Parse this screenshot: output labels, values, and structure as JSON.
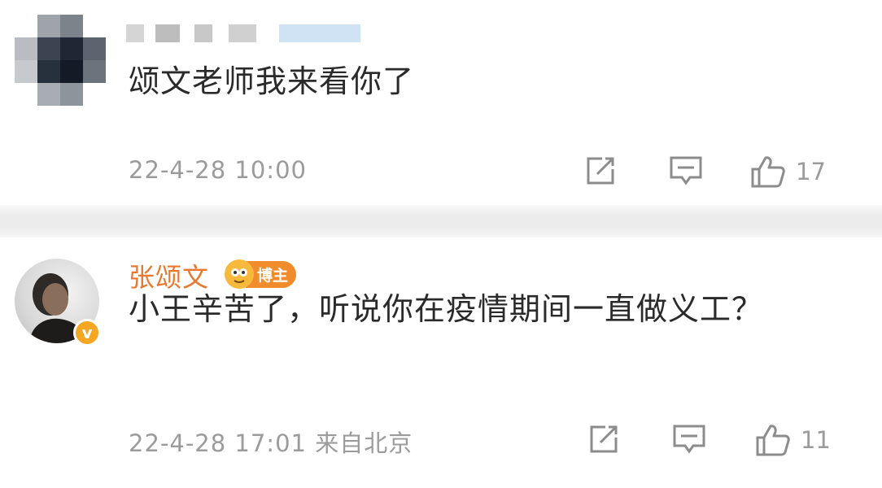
{
  "comments": [
    {
      "username": "",
      "text": "颂文老师我来看你了",
      "meta": "22-4-28 10:00",
      "likes": "17"
    },
    {
      "username": "张颂文",
      "badge": "博主",
      "text": "小王辛苦了，听说你在疫情期间一直做义工？",
      "meta": "22-4-28 17:01 来自北京",
      "likes": "11"
    }
  ],
  "icons": {
    "share": "share-icon",
    "comment": "comment-icon",
    "like": "thumbs-up-icon",
    "verified": "verified-icon"
  },
  "colors": {
    "username": "#e8782d",
    "badge": "#f08c2b",
    "meta": "#9b9b9b"
  }
}
